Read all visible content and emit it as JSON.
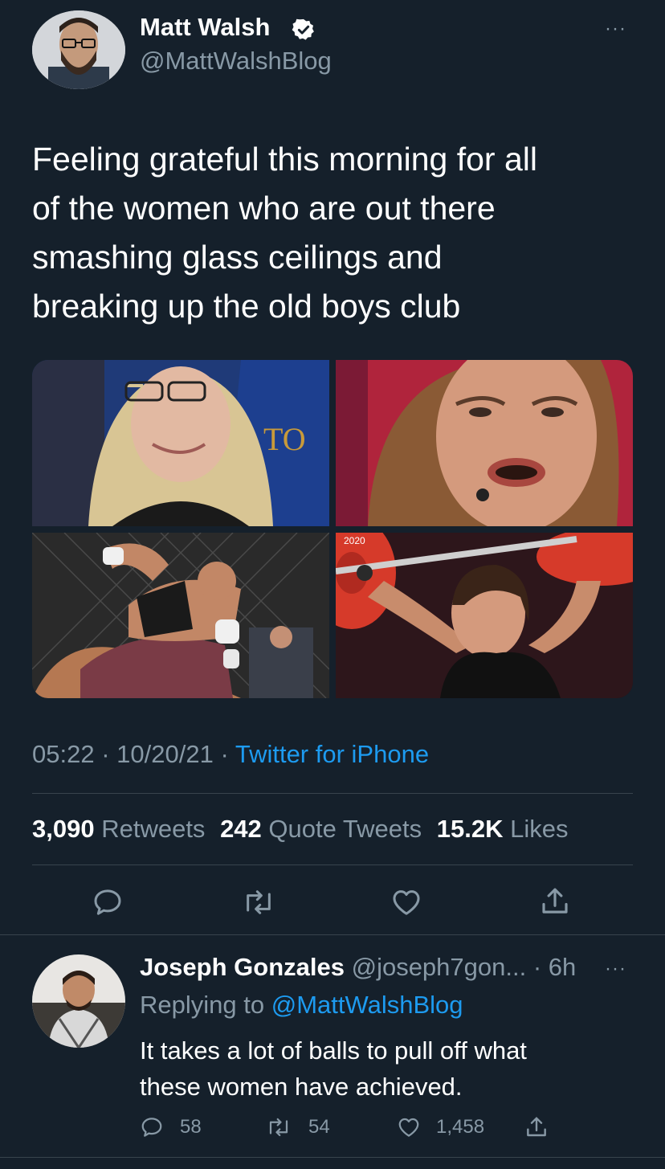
{
  "tweet": {
    "author_name": "Matt Walsh",
    "author_handle": "@MattWalshBlog",
    "more_label": "···",
    "text_lines": [
      "Feeling grateful this morning for all",
      "of the women who are out there",
      "smashing glass ceilings and",
      "breaking up the old boys club"
    ],
    "time": "05:22",
    "date": "10/20/21",
    "sep": "·",
    "source": "Twitter for iPhone",
    "stats": {
      "retweets_count": "3,090",
      "retweets_label": "Retweets",
      "quotes_count": "242",
      "quotes_label": "Quote Tweets",
      "likes_count": "15.2K",
      "likes_label": "Likes"
    },
    "images": [
      {
        "icon": "photo-woman-glasses",
        "overlay_text": "TO"
      },
      {
        "icon": "photo-woman-closeup"
      },
      {
        "icon": "photo-mma-fight"
      },
      {
        "icon": "photo-weightlifter",
        "overlay_text": "2020"
      }
    ],
    "actions": [
      "reply-icon",
      "retweet-icon",
      "like-icon",
      "share-icon"
    ]
  },
  "reply": {
    "author_name": "Joseph Gonzales",
    "author_handle": "@joseph7gon...",
    "time": "· 6h",
    "more_label": "···",
    "replying_prefix": "Replying to",
    "replying_to": "@MattWalshBlog",
    "text_lines": [
      "It takes a lot of balls to pull off what",
      "these women have achieved."
    ],
    "replies_count": "58",
    "retweets_count": "54",
    "likes_count": "1,458"
  },
  "colors": {
    "background": "#15202b",
    "accent": "#1d9bf0",
    "muted": "#8899a6",
    "divider": "#38444d"
  }
}
